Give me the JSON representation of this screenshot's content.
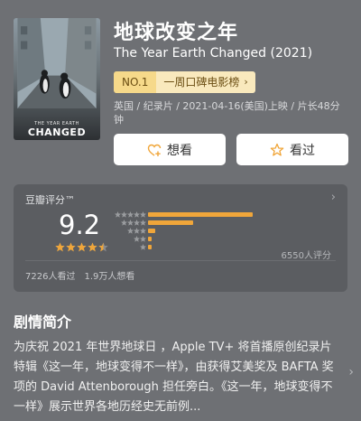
{
  "movie": {
    "title_cn": "地球改变之年",
    "title_en": "The Year Earth Changed (2021)",
    "poster_line1": "THE YEAR EARTH",
    "poster_line2": "CHANGED",
    "rank_no": "NO.1",
    "rank_name": "一周口碑电影榜",
    "meta": "英国 / 纪录片 / 2021-04-16(美国)上映 / 片长48分钟"
  },
  "actions": {
    "want_label": "想看",
    "seen_label": "看过"
  },
  "rating": {
    "label": "豆瓣评分™",
    "score": "9.2",
    "score_stars": 4.5,
    "distribution": [
      {
        "stars": 5,
        "fraction": 0.58
      },
      {
        "stars": 4,
        "fraction": 0.25
      },
      {
        "stars": 3,
        "fraction": 0.04
      },
      {
        "stars": 2,
        "fraction": 0.02
      },
      {
        "stars": 1,
        "fraction": 0.02
      }
    ],
    "count_text": "6550人评分",
    "seen_text": "7226人看过",
    "want_text": "1.9万人想看"
  },
  "synopsis": {
    "heading": "剧情简介",
    "text": "为庆祝 2021 年世界地球日 ，Apple TV+ 将首播原创纪录片特辑《这一年，地球变得不一样》，由获得艾美奖及 BAFTA 奖项的 David Attenborough 担任旁白。《这一年，地球变得不一样》展示世界各地历经史无前例..."
  },
  "colors": {
    "background": "#6e7074",
    "card": "#5b5d61",
    "star": "#f0a63a",
    "badge_no": "#f6d98a",
    "badge_name": "#f9e9bd"
  },
  "icons": {
    "want": "heart-plus-icon",
    "seen": "star-outline-icon",
    "chevron": "chevron-right-icon"
  }
}
